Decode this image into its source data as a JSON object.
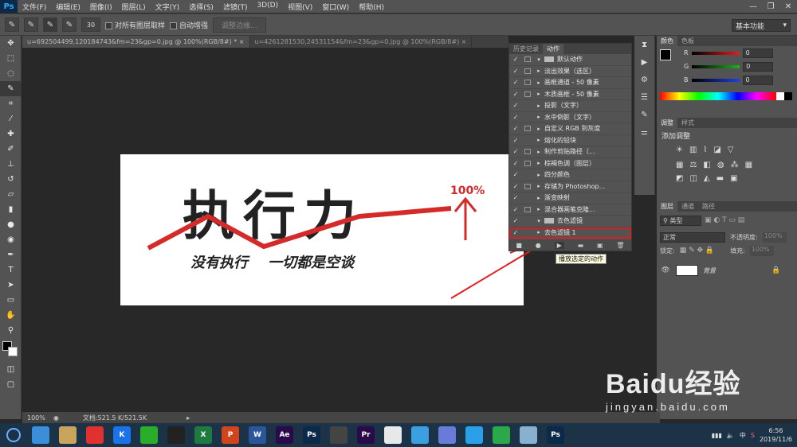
{
  "app": {
    "logo": "Ps"
  },
  "menu": [
    "文件(F)",
    "编辑(E)",
    "图像(I)",
    "图层(L)",
    "文字(Y)",
    "选择(S)",
    "滤镜(T)",
    "3D(D)",
    "视图(V)",
    "窗口(W)",
    "帮助(H)"
  ],
  "window_controls": [
    "—",
    "❐",
    "✕"
  ],
  "options": {
    "brush_size": "30",
    "sample_all": "对所有图层取样",
    "auto_enhance": "自动增强",
    "refine_edge": "调整边缘...",
    "workspace": "基本功能"
  },
  "tabs": [
    {
      "label": "u=692504499,120184743&fm=23&gp=0.jpg @ 100%(RGB/8#) *"
    },
    {
      "label": "u=4261281530,24531154&fm=23&gp=0.jpg @ 100%(RGB/8#)"
    }
  ],
  "canvas": {
    "main_text": "执行力",
    "percent": "100%",
    "subtitle": "没有执行    一切都是空谈"
  },
  "status": {
    "zoom": "100%",
    "doc": "文档:521.5 K/521.5K"
  },
  "actions_panel": {
    "tabs": [
      "历史记录",
      "动作"
    ],
    "tooltip": "播放选定的动作",
    "rows": [
      {
        "check": "✓",
        "dialog": true,
        "exp": "▾",
        "label": "默认动作",
        "folder": true
      },
      {
        "check": "✓",
        "dialog": true,
        "exp": "▸",
        "label": "淡出效果（选区）"
      },
      {
        "check": "✓",
        "dialog": true,
        "exp": "▸",
        "label": "画框通道 - 50 像素"
      },
      {
        "check": "✓",
        "dialog": true,
        "exp": "▸",
        "label": "木质画框 - 50 像素"
      },
      {
        "check": "✓",
        "dialog": false,
        "exp": "▸",
        "label": "投影（文字）"
      },
      {
        "check": "✓",
        "dialog": false,
        "exp": "▸",
        "label": "水中倒影（文字）"
      },
      {
        "check": "✓",
        "dialog": true,
        "exp": "▸",
        "label": "自定义 RGB 到灰度"
      },
      {
        "check": "✓",
        "dialog": false,
        "exp": "▸",
        "label": "熔化的铅块"
      },
      {
        "check": "✓",
        "dialog": true,
        "exp": "▸",
        "label": "制作剪贴路径（..."
      },
      {
        "check": "✓",
        "dialog": true,
        "exp": "▸",
        "label": "棕褐色调（图层）"
      },
      {
        "check": "✓",
        "dialog": false,
        "exp": "▸",
        "label": "四分颜色"
      },
      {
        "check": "✓",
        "dialog": true,
        "exp": "▸",
        "label": "存储为 Photoshop..."
      },
      {
        "check": "✓",
        "dialog": false,
        "exp": "▸",
        "label": "渐变映射"
      },
      {
        "check": "✓",
        "dialog": true,
        "exp": "▸",
        "label": "混合器画笔克隆..."
      },
      {
        "check": "✓",
        "dialog": false,
        "exp": "▾",
        "label": "去色滤镜",
        "folder": true
      },
      {
        "check": "✓",
        "dialog": false,
        "exp": "▸",
        "label": "去色滤镜 1",
        "selected": true
      }
    ],
    "footer": [
      "■",
      "●",
      "▶",
      "▬",
      "▣",
      "🗑"
    ]
  },
  "color_panel": {
    "tabs": [
      "颜色",
      "色板"
    ],
    "channels": [
      {
        "name": "R",
        "value": "0",
        "color": "#e02020"
      },
      {
        "name": "G",
        "value": "0",
        "color": "#20b020"
      },
      {
        "name": "B",
        "value": "0",
        "color": "#2040e0"
      }
    ]
  },
  "adjust_panel": {
    "tabs": [
      "调整",
      "样式"
    ],
    "title": "添加调整"
  },
  "layers_panel": {
    "tabs": [
      "图层",
      "通道",
      "路径"
    ],
    "kind": "类型",
    "blend": "正常",
    "opacity_label": "不透明度:",
    "opacity": "100%",
    "lock_label": "锁定:",
    "fill_label": "填充:",
    "fill": "100%",
    "layer_name": "背景"
  },
  "taskbar": {
    "apps": [
      {
        "label": "",
        "color": "#3a8fd8"
      },
      {
        "label": "",
        "color": "#c9a45c"
      },
      {
        "label": "",
        "color": "#e03030"
      },
      {
        "label": "K",
        "color": "#1a73e8"
      },
      {
        "label": "",
        "color": "#2aae2a"
      },
      {
        "label": "",
        "color": "#222222"
      },
      {
        "label": "X",
        "color": "#1e7a3e"
      },
      {
        "label": "P",
        "color": "#d0451b"
      },
      {
        "label": "W",
        "color": "#2b579a"
      },
      {
        "label": "Ae",
        "color": "#2a0a4a"
      },
      {
        "label": "Ps",
        "color": "#0b2a4a"
      },
      {
        "label": "",
        "color": "#444444"
      },
      {
        "label": "Pr",
        "color": "#2a0a4a"
      },
      {
        "label": "",
        "color": "#e8e8e8"
      },
      {
        "label": "",
        "color": "#3aa0e0"
      },
      {
        "label": "",
        "color": "#6a7ad8"
      },
      {
        "label": "",
        "color": "#2aa0e8"
      },
      {
        "label": "",
        "color": "#2aa84a"
      },
      {
        "label": "",
        "color": "#8ab0d0"
      },
      {
        "label": "Ps",
        "color": "#0b2a4a"
      }
    ],
    "tray_ime": "中",
    "time": "6:56",
    "date": "2019/11/6"
  },
  "watermark": {
    "brand": "Baidu经验",
    "url": "jingyan.baidu.com"
  }
}
